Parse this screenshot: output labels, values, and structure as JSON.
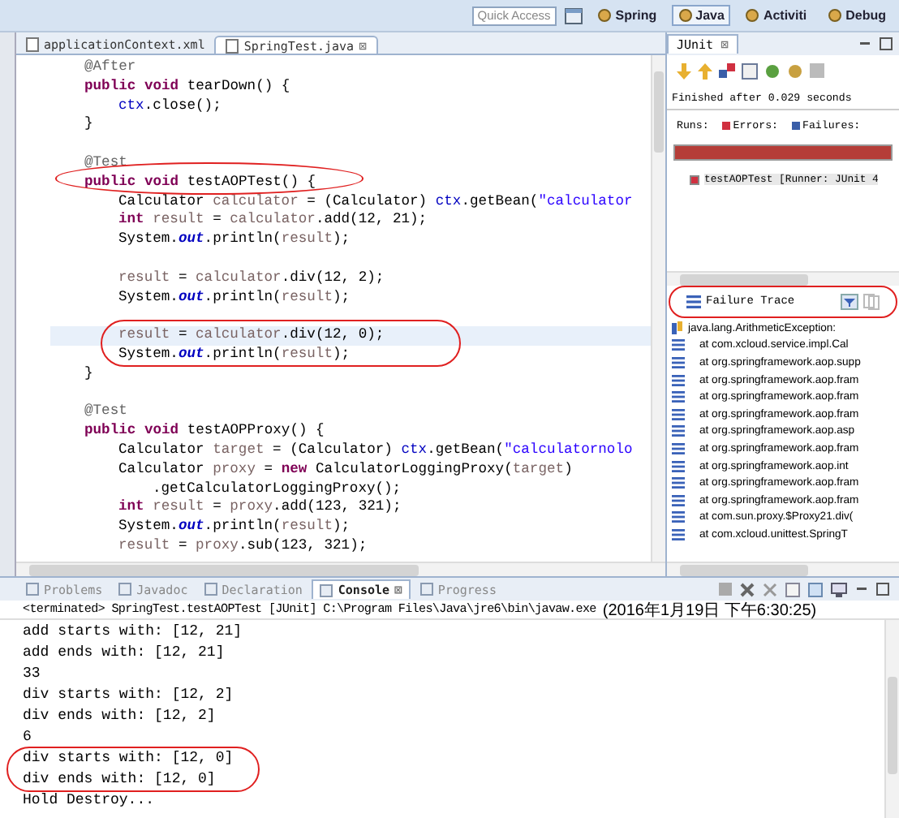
{
  "toolbar": {
    "quick_access": {
      "placeholder": "Quick Access"
    },
    "perspectives": [
      {
        "label": "Spring",
        "selected": false
      },
      {
        "label": "Java",
        "selected": true
      },
      {
        "label": "Activiti",
        "selected": false
      },
      {
        "label": "Debug",
        "selected": false
      }
    ]
  },
  "editor": {
    "tabs": [
      {
        "label": "applicationContext.xml",
        "selected": false
      },
      {
        "label": "SpringTest.java",
        "selected": true,
        "close": "⊠"
      }
    ],
    "lines": [
      {
        "kind": "member",
        "tokens": [
          {
            "kind": "ann",
            "text": "@After"
          }
        ]
      },
      {
        "kind": "member",
        "tokens": [
          {
            "kind": "kw",
            "text": "public void"
          },
          {
            "kind": "plain",
            "text": " tearDown() {"
          }
        ]
      },
      {
        "kind": "body",
        "tokens": [
          {
            "kind": "field",
            "text": "ctx"
          },
          {
            "kind": "plain",
            "text": ".close();"
          }
        ]
      },
      {
        "kind": "member",
        "tokens": [
          {
            "kind": "plain",
            "text": "}"
          }
        ]
      },
      {
        "kind": "blank"
      },
      {
        "kind": "member",
        "tokens": [
          {
            "kind": "ann",
            "text": "@Test"
          }
        ]
      },
      {
        "kind": "member",
        "tokens": [
          {
            "kind": "kw",
            "text": "public void"
          },
          {
            "kind": "plain",
            "text": " testAOPTest() {"
          }
        ]
      },
      {
        "kind": "body",
        "tokens": [
          {
            "kind": "plain",
            "text": "Calculator"
          },
          {
            "kind": "var",
            "text": " calculator"
          },
          {
            "kind": "plain",
            "text": " = (Calculator) "
          },
          {
            "kind": "field",
            "text": "ctx"
          },
          {
            "kind": "plain",
            "text": ".getBean("
          },
          {
            "kind": "str",
            "text": "\"calculator"
          }
        ]
      },
      {
        "kind": "body",
        "tokens": [
          {
            "kind": "kw",
            "text": "int"
          },
          {
            "kind": "var",
            "text": " result"
          },
          {
            "kind": "plain",
            "text": " = "
          },
          {
            "kind": "var",
            "text": "calculator"
          },
          {
            "kind": "plain",
            "text": ".add(12, 21);"
          }
        ]
      },
      {
        "kind": "body",
        "tokens": [
          {
            "kind": "plain",
            "text": "System."
          },
          {
            "kind": "static",
            "text": "out"
          },
          {
            "kind": "plain",
            "text": ".println("
          },
          {
            "kind": "var",
            "text": "result"
          },
          {
            "kind": "plain",
            "text": ");"
          }
        ]
      },
      {
        "kind": "blank"
      },
      {
        "kind": "body",
        "tokens": [
          {
            "kind": "var",
            "text": "result"
          },
          {
            "kind": "plain",
            "text": " = "
          },
          {
            "kind": "var",
            "text": "calculator"
          },
          {
            "kind": "plain",
            "text": ".div(12, 2);"
          }
        ]
      },
      {
        "kind": "body",
        "tokens": [
          {
            "kind": "plain",
            "text": "System."
          },
          {
            "kind": "static",
            "text": "out"
          },
          {
            "kind": "plain",
            "text": ".println("
          },
          {
            "kind": "var",
            "text": "result"
          },
          {
            "kind": "plain",
            "text": ");"
          }
        ]
      },
      {
        "kind": "blank"
      },
      {
        "kind": "body",
        "current": true,
        "tokens": [
          {
            "kind": "var",
            "text": "result"
          },
          {
            "kind": "plain",
            "text": " = "
          },
          {
            "kind": "var",
            "text": "calculator"
          },
          {
            "kind": "plain",
            "text": ".div(12, 0);"
          }
        ]
      },
      {
        "kind": "body",
        "tokens": [
          {
            "kind": "plain",
            "text": "System."
          },
          {
            "kind": "static",
            "text": "out"
          },
          {
            "kind": "plain",
            "text": ".println("
          },
          {
            "kind": "var",
            "text": "result"
          },
          {
            "kind": "plain",
            "text": ");"
          }
        ]
      },
      {
        "kind": "member",
        "tokens": [
          {
            "kind": "plain",
            "text": "}"
          }
        ]
      },
      {
        "kind": "blank"
      },
      {
        "kind": "member",
        "tokens": [
          {
            "kind": "ann",
            "text": "@Test"
          }
        ]
      },
      {
        "kind": "member",
        "tokens": [
          {
            "kind": "kw",
            "text": "public void"
          },
          {
            "kind": "plain",
            "text": " testAOPProxy() {"
          }
        ]
      },
      {
        "kind": "body",
        "tokens": [
          {
            "kind": "plain",
            "text": "Calculator"
          },
          {
            "kind": "var",
            "text": " target"
          },
          {
            "kind": "plain",
            "text": " = (Calculator) "
          },
          {
            "kind": "field",
            "text": "ctx"
          },
          {
            "kind": "plain",
            "text": ".getBean("
          },
          {
            "kind": "str",
            "text": "\"calculatornolo"
          }
        ]
      },
      {
        "kind": "body",
        "tokens": [
          {
            "kind": "plain",
            "text": "Calculator"
          },
          {
            "kind": "var",
            "text": " proxy"
          },
          {
            "kind": "plain",
            "text": " = "
          },
          {
            "kind": "kw",
            "text": "new"
          },
          {
            "kind": "plain",
            "text": " CalculatorLoggingProxy("
          },
          {
            "kind": "var",
            "text": "target"
          },
          {
            "kind": "plain",
            "text": ")"
          }
        ]
      },
      {
        "kind": "wrap",
        "tokens": [
          {
            "kind": "plain",
            "text": ".getCalculatorLoggingProxy();"
          }
        ]
      },
      {
        "kind": "body",
        "tokens": [
          {
            "kind": "kw",
            "text": "int"
          },
          {
            "kind": "var",
            "text": " result"
          },
          {
            "kind": "plain",
            "text": " = "
          },
          {
            "kind": "var",
            "text": "proxy"
          },
          {
            "kind": "plain",
            "text": ".add(123, 321);"
          }
        ]
      },
      {
        "kind": "body",
        "tokens": [
          {
            "kind": "plain",
            "text": "System."
          },
          {
            "kind": "static",
            "text": "out"
          },
          {
            "kind": "plain",
            "text": ".println("
          },
          {
            "kind": "var",
            "text": "result"
          },
          {
            "kind": "plain",
            "text": ");"
          }
        ]
      },
      {
        "kind": "body",
        "tokens": [
          {
            "kind": "var",
            "text": "result"
          },
          {
            "kind": "plain",
            "text": " = "
          },
          {
            "kind": "var",
            "text": "proxy"
          },
          {
            "kind": "plain",
            "text": ".sub(123, 321);"
          }
        ]
      }
    ]
  },
  "junit": {
    "title": "JUnit",
    "close": "⊠",
    "status": "Finished after 0.029 seconds",
    "counters": [
      {
        "label": "Runs:",
        "kind": "runs"
      },
      {
        "label": "Errors:",
        "kind": "errors"
      },
      {
        "label": "Failures:",
        "kind": "failures"
      }
    ],
    "progress": {
      "level": 1,
      "failed": true
    },
    "tests": [
      {
        "label": "testAOPTest [Runner: JUnit 4",
        "failed": true
      }
    ],
    "failure_trace": {
      "title": "Failure Trace",
      "lines": [
        {
          "kind": "exception",
          "text": "java.lang.ArithmeticException:"
        },
        {
          "kind": "frame",
          "text": "at com.xcloud.service.impl.Cal"
        },
        {
          "kind": "frame",
          "text": "at org.springframework.aop.supp"
        },
        {
          "kind": "frame",
          "text": "at org.springframework.aop.fram"
        },
        {
          "kind": "frame",
          "text": "at org.springframework.aop.fram"
        },
        {
          "kind": "frame",
          "text": "at org.springframework.aop.fram"
        },
        {
          "kind": "frame",
          "text": "at org.springframework.aop.asp"
        },
        {
          "kind": "frame",
          "text": "at org.springframework.aop.fram"
        },
        {
          "kind": "frame",
          "text": "at org.springframework.aop.int"
        },
        {
          "kind": "frame",
          "text": "at org.springframework.aop.fram"
        },
        {
          "kind": "frame",
          "text": "at org.springframework.aop.fram"
        },
        {
          "kind": "frame",
          "text": "at com.sun.proxy.$Proxy21.div("
        },
        {
          "kind": "frame",
          "text": "at com.xcloud.unittest.SpringT"
        }
      ]
    }
  },
  "bottom": {
    "tabs": [
      {
        "label": "Problems",
        "selected": false
      },
      {
        "label": "Javadoc",
        "selected": false
      },
      {
        "label": "Declaration",
        "selected": false
      },
      {
        "label": "Console",
        "selected": true,
        "close": "⊠"
      },
      {
        "label": "Progress",
        "selected": false
      }
    ],
    "console": {
      "status": "<terminated> SpringTest.testAOPTest [JUnit] C:\\Program Files\\Java\\jre6\\bin\\javaw.exe",
      "time": "(2016年1月19日 下午6:30:25)",
      "lines": [
        "add starts with: [12, 21]",
        "add ends with: [12, 21]",
        "33",
        "div starts with: [12, 2]",
        "div ends with: [12, 2]",
        "6",
        "div starts with: [12, 0]",
        "div ends with: [12, 0]",
        "Hold Destroy..."
      ]
    }
  }
}
